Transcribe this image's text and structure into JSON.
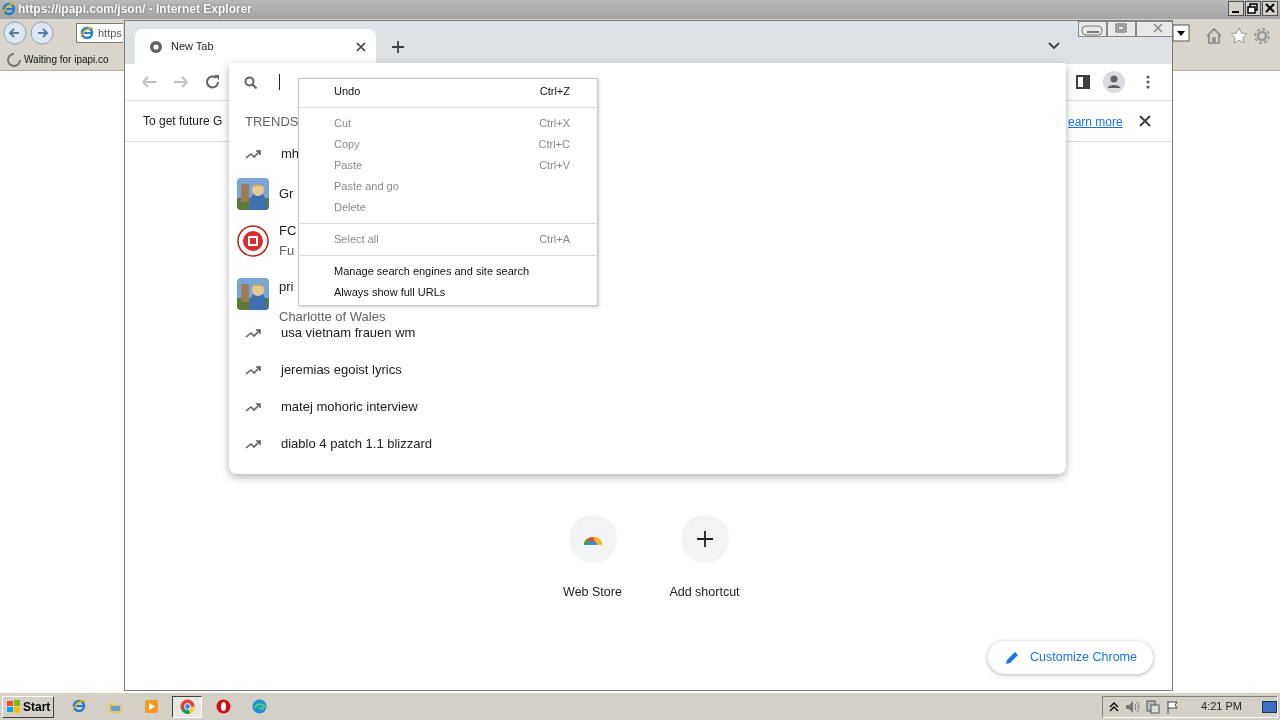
{
  "ie_window": {
    "title": "https://ipapi.com/json/ - Internet Explorer",
    "address": "https",
    "tab": "Waiting for ipapi.co"
  },
  "chrome": {
    "tab": {
      "title": "New Tab"
    },
    "infobar": {
      "text": "To get future G",
      "link": "earn more"
    },
    "omnibox": {
      "section": "TRENDS",
      "suggestions": [
        {
          "kind": "trend",
          "text": "mh"
        },
        {
          "kind": "picture",
          "text": "Gr"
        },
        {
          "kind": "logo",
          "text": "FC",
          "detail": "Fu"
        },
        {
          "kind": "picture",
          "text": "pri",
          "detail": "Charlotte of Wales"
        },
        {
          "kind": "trend",
          "text": "usa vietnam frauen wm"
        },
        {
          "kind": "trend",
          "text": "jeremias egoist lyrics"
        },
        {
          "kind": "trend",
          "text": "matej mohoric interview"
        },
        {
          "kind": "trend",
          "text": "diablo 4 patch 1.1 blizzard"
        }
      ]
    },
    "context_menu": {
      "groups": [
        [
          {
            "label": "Undo",
            "shortcut": "Ctrl+Z",
            "disabled": false
          }
        ],
        [
          {
            "label": "Cut",
            "shortcut": "Ctrl+X",
            "disabled": true
          },
          {
            "label": "Copy",
            "shortcut": "Ctrl+C",
            "disabled": true
          },
          {
            "label": "Paste",
            "shortcut": "Ctrl+V",
            "disabled": true
          },
          {
            "label": "Paste and go",
            "disabled": true
          },
          {
            "label": "Delete",
            "disabled": true
          }
        ],
        [
          {
            "label": "Select all",
            "shortcut": "Ctrl+A",
            "disabled": true
          }
        ],
        [
          {
            "label": "Manage search engines and site search",
            "disabled": false
          },
          {
            "label": "Always show full URLs",
            "disabled": false
          }
        ]
      ]
    },
    "shortcuts": [
      {
        "kind": "webstore",
        "label": "Web Store"
      },
      {
        "kind": "add",
        "label": "Add shortcut"
      }
    ],
    "customize": "Customize Chrome"
  },
  "taskbar": {
    "start": "Start",
    "apps": [
      {
        "kind": "ie",
        "selected": false
      },
      {
        "kind": "folder",
        "selected": false
      },
      {
        "kind": "media",
        "selected": false
      },
      {
        "kind": "chrome",
        "selected": true
      },
      {
        "kind": "opera",
        "selected": false
      },
      {
        "kind": "edge",
        "selected": false
      }
    ],
    "clock": "4:21 PM"
  }
}
